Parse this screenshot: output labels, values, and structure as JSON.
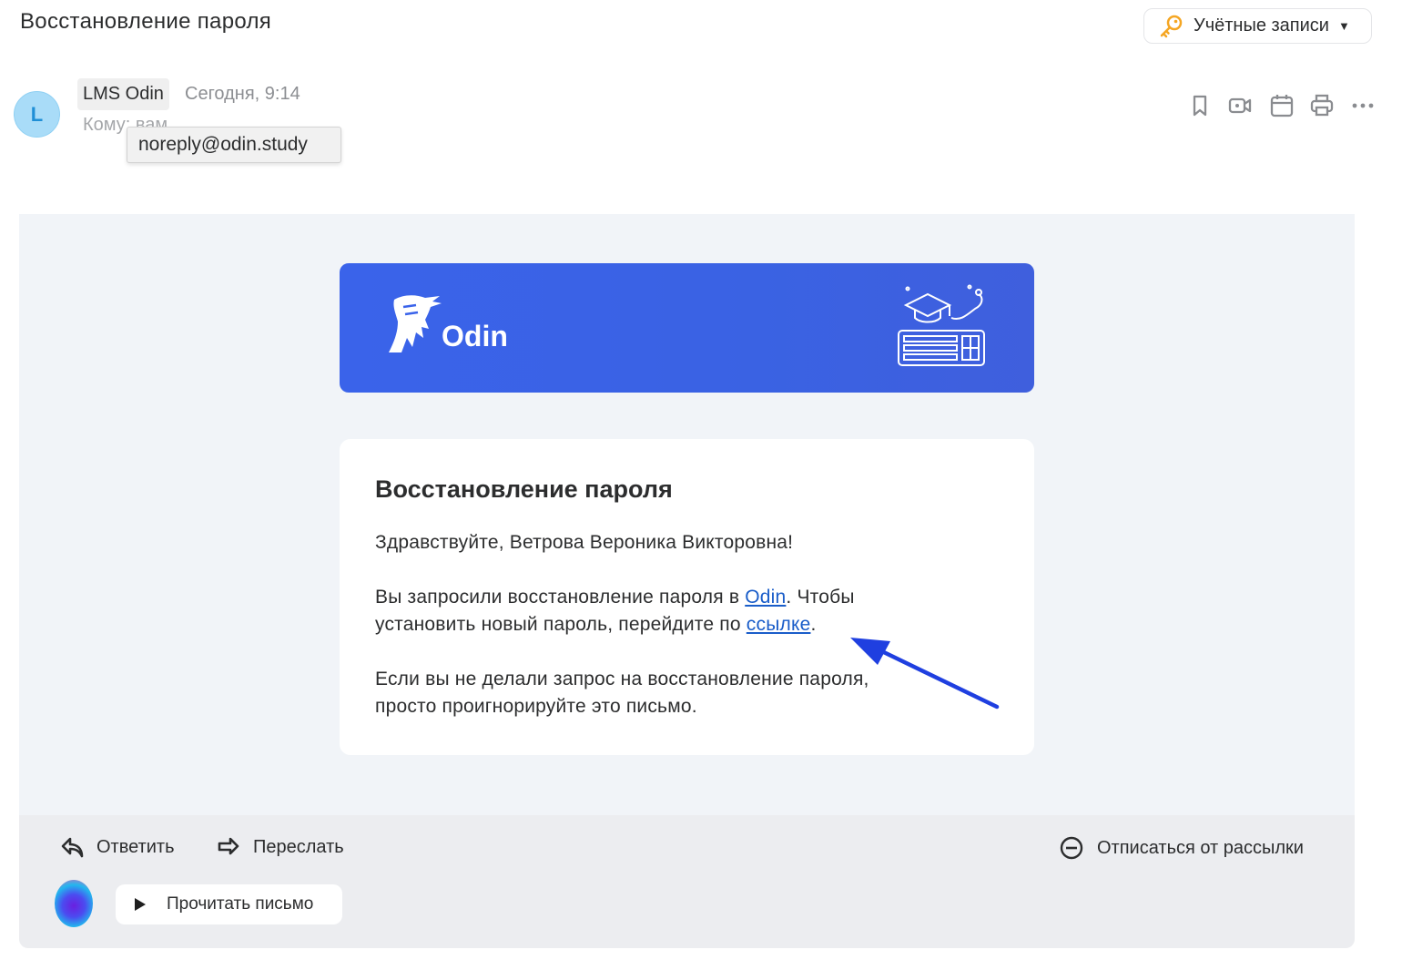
{
  "header": {
    "subject": "Восстановление пароля",
    "accounts_label": "Учётные записи",
    "accounts_caret": "▼"
  },
  "message": {
    "avatar_letter": "L",
    "sender_name": "LMS Odin",
    "date": "Сегодня, 9:14",
    "to_label": "Кому: вам",
    "tooltip_email": "noreply@odin.study",
    "actions": [
      "bookmark-icon",
      "video-icon",
      "calendar-icon",
      "print-icon",
      "more-icon"
    ]
  },
  "banner": {
    "brand": "Odin"
  },
  "card": {
    "title": "Восстановление пароля",
    "greeting": "Здравствуйте, Ветрова Вероника Викторовна!",
    "p2_part1": "Вы запросили восстановление пароля в ",
    "p2_link1": "Odin",
    "p2_part2": ". Чтобы",
    "p2_part3": "установить новый пароль, перейдите по ",
    "p2_link2": "ссылке",
    "p2_part4": ".",
    "p3_line1": "Если вы не делали запрос на восстановление пароля,",
    "p3_line2": "просто проигнорируйте это письмо."
  },
  "footer": {
    "reply": "Ответить",
    "forward": "Переслать",
    "unsubscribe": "Отписаться от рассылки",
    "read_aloud": "Прочитать письмо"
  },
  "colors": {
    "banner_blue": "#3a63ea",
    "link": "#1a5dc9",
    "arrow": "#1f3fe0",
    "key_orange": "#f5a623"
  }
}
